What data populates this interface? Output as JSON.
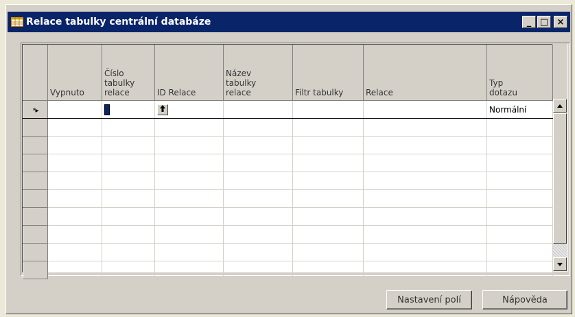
{
  "window": {
    "title": "Relace tabulky centrální databáze",
    "minimize_label": "_",
    "maximize_label": "□",
    "close_label": "×"
  },
  "grid": {
    "columns": [
      {
        "label": "Vypnuto"
      },
      {
        "label": "Číslo\ntabulky\nrelace"
      },
      {
        "label": "ID Relace"
      },
      {
        "label": "Název\ntabulky\nrelace"
      },
      {
        "label": "Filtr tabulky"
      },
      {
        "label": "Relace"
      },
      {
        "label": "Typ\ndotazu"
      }
    ],
    "new_row_marker": "*▸",
    "new_row": {
      "query_type": "Normální"
    },
    "empty_rows": 9
  },
  "buttons": {
    "field_settings": "Nastavení polí",
    "help": "Nápověda"
  },
  "colors": {
    "titlebar": "#0a246a",
    "window_face": "#d4d0c8"
  },
  "icons": {
    "title_icon": "table-icon",
    "lookup": "arrow-up-icon"
  }
}
